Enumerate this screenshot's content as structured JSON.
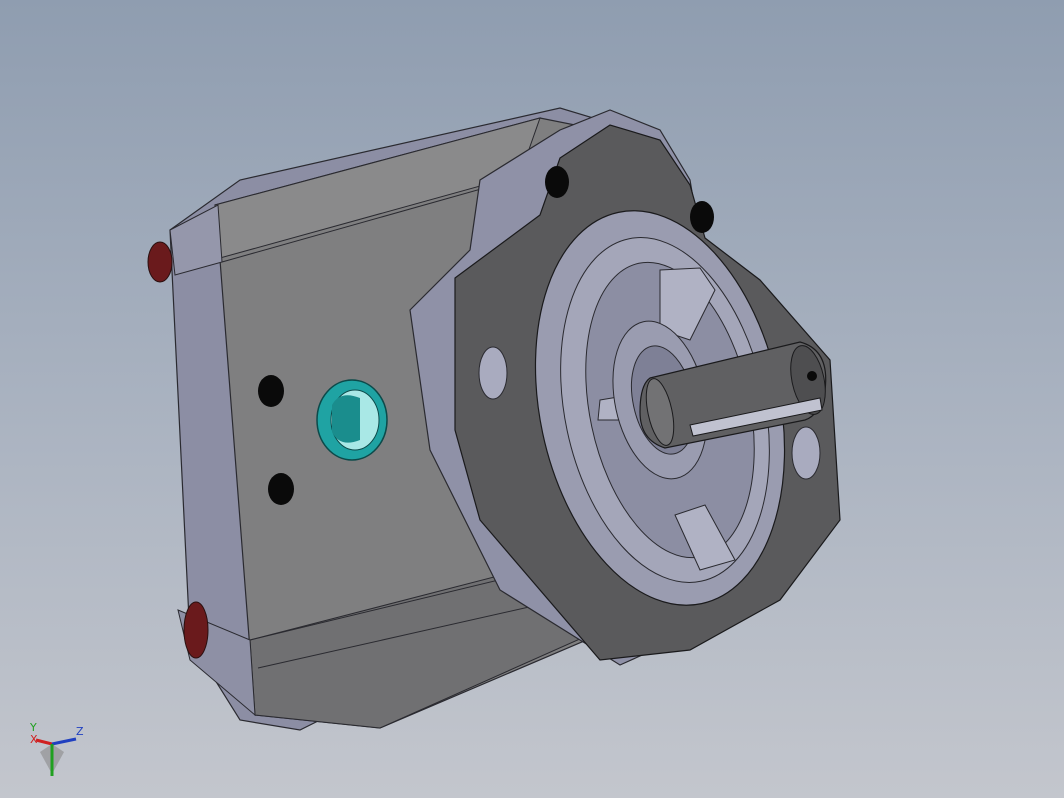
{
  "viewport": {
    "background_top": "#8f9db0",
    "background_bottom": "#c3c6cd"
  },
  "model": {
    "description_icon": "gear-pump-3d-model",
    "colors": {
      "housing": "#7f7f80",
      "housing_dark": "#6a6a6c",
      "end_cover": "#8c8ea4",
      "flange": "#5a5a5c",
      "flange_edge": "#9799ae",
      "port_fitting": "#1fa3a3",
      "pins": "#6a1a1c",
      "shaft": "#606062"
    }
  },
  "triad": {
    "x_label": "X",
    "y_label": "Y",
    "z_label": "Z",
    "x_color": "#d02020",
    "y_color": "#20a020",
    "z_color": "#2040c0"
  }
}
